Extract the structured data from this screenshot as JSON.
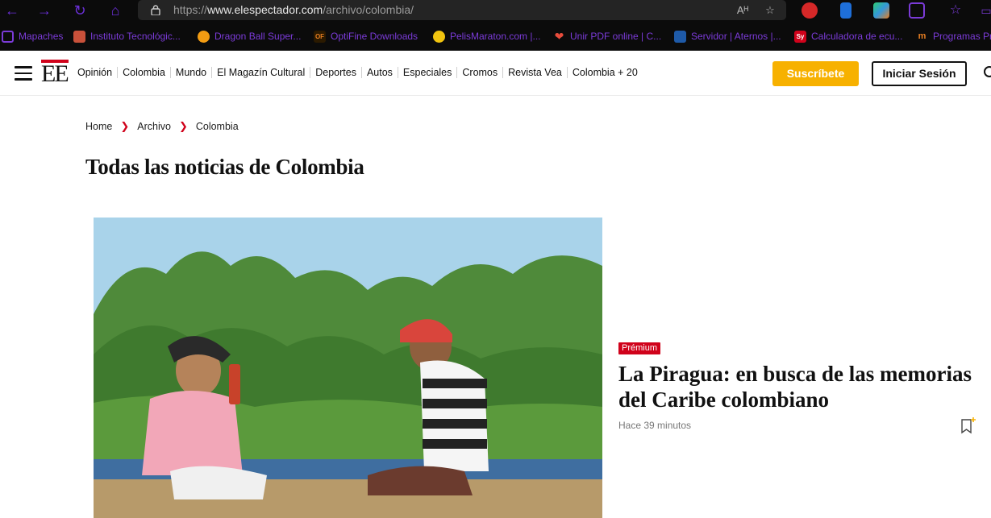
{
  "browser": {
    "url_prefix": "https://",
    "url_domain": "www.elespectador.com",
    "url_path": "/archivo/colombia/",
    "bookmarks": [
      {
        "label": "Mapaches",
        "icon": "folder-icon",
        "color": "#7b3bd8"
      },
      {
        "label": "Instituto Tecnológic...",
        "icon": "institute-icon",
        "color": "#c9513a"
      },
      {
        "label": "Dragon Ball Super...",
        "icon": "dragonball-icon",
        "color": "#f39c12"
      },
      {
        "label": "OptiFine Downloads",
        "icon": "optifine-icon",
        "color": "#e67e22"
      },
      {
        "label": "PelisMaraton.com |...",
        "icon": "pelismaraton-icon",
        "color": "#f1c40f"
      },
      {
        "label": "Unir PDF online | C...",
        "icon": "heart-pdf-icon",
        "color": "#e74c3c"
      },
      {
        "label": "Servidor | Aternos |...",
        "icon": "aternos-icon",
        "color": "#3498db"
      },
      {
        "label": "Calculadora de ecu...",
        "icon": "symbolab-icon",
        "color": "#d0021b"
      },
      {
        "label": "Programas Pr",
        "icon": "programas-icon",
        "color": "#e67e22"
      }
    ]
  },
  "site": {
    "logo_text": "EE",
    "nav": [
      "Opinión",
      "Colombia",
      "Mundo",
      "El Magazín Cultural",
      "Deportes",
      "Autos",
      "Especiales",
      "Cromos",
      "Revista Vea",
      "Colombia + 20"
    ],
    "subscribe_label": "Suscríbete",
    "login_label": "Iniciar Sesión"
  },
  "breadcrumb": [
    "Home",
    "Archivo",
    "Colombia"
  ],
  "page_title": "Todas las noticias de Colombia",
  "article": {
    "badge": "Prémium",
    "headline": "La Piragua: en busca de las memorias del Caribe colombiano",
    "time": "Hace 39 minutos"
  },
  "colors": {
    "brand_red": "#d0021b",
    "subscribe_yellow": "#f7b100",
    "browser_accent": "#7b3bd8"
  }
}
